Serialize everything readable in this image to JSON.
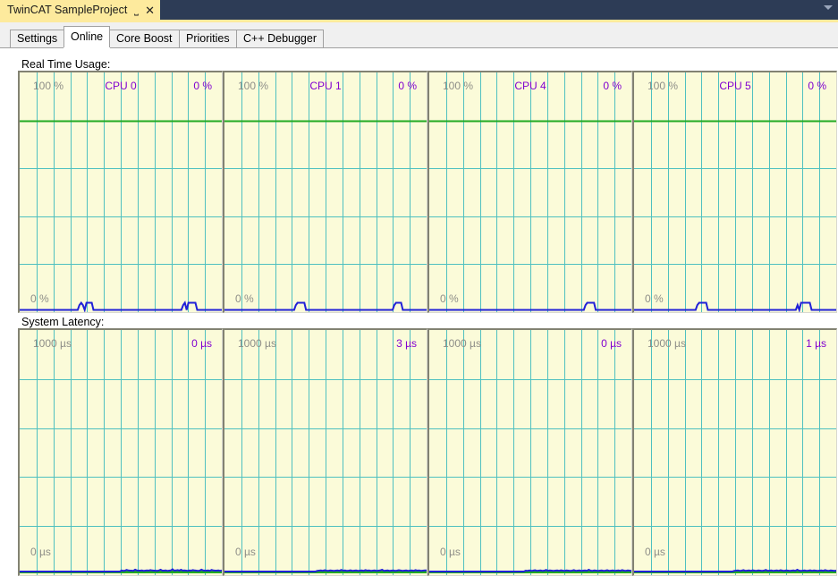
{
  "window": {
    "document_tab_title": "TwinCAT SampleProject",
    "pin_icon": "pin-icon",
    "close_icon": "close-icon",
    "menu_chevron_icon": "chevron-down-icon",
    "titlebar_color": "#2d3c56",
    "tab_color": "#fdea9d"
  },
  "tabs": [
    {
      "label": "Settings",
      "active": false
    },
    {
      "label": "Online",
      "active": true
    },
    {
      "label": "Core Boost",
      "active": false
    },
    {
      "label": "Priorities",
      "active": false
    },
    {
      "label": "C++ Debugger",
      "active": false
    }
  ],
  "sections": {
    "realtime_usage_label": "Real Time Usage:",
    "system_latency_label": "System Latency:"
  },
  "colors": {
    "chart_background": "#fbfbd9",
    "grid_line": "#4fc0c0",
    "trace_line": "#2020d8",
    "limit_line": "#22aa22",
    "axis_label": "#8e8e88",
    "value_label": "#8000d0",
    "frame_dark": "#828272"
  },
  "chart_data": [
    {
      "type": "line",
      "group": "Real Time Usage",
      "title": "CPU 0",
      "ylabel_max": "100 %",
      "ylabel_min": "0 %",
      "current_value": "0 %",
      "ylim": [
        0,
        100
      ],
      "limit_line_value": 80,
      "grid": {
        "vertical_lines": 11,
        "horizontal_lines": 4
      },
      "values": [
        0,
        0,
        0,
        0,
        0,
        0,
        0,
        0,
        0,
        0,
        0,
        0,
        0,
        0,
        0,
        0,
        0,
        0,
        0,
        0,
        0,
        0,
        0,
        0,
        0,
        0,
        0,
        0,
        0,
        0,
        0,
        0,
        0,
        0,
        2,
        3,
        2,
        0,
        3,
        3,
        3,
        3,
        0,
        0,
        0,
        0,
        0,
        0,
        0,
        0,
        0,
        0,
        0,
        0,
        0,
        0,
        0,
        0,
        0,
        0,
        0,
        0,
        0,
        0,
        0,
        0,
        0,
        0,
        0,
        0,
        0,
        0,
        0,
        0,
        0,
        0,
        0,
        0,
        0,
        0,
        0,
        0,
        0,
        0,
        0,
        0,
        0,
        0,
        0,
        0,
        0,
        0,
        0,
        2,
        3,
        0,
        3,
        3,
        3,
        3,
        3,
        0,
        0,
        0,
        0,
        0,
        0,
        0,
        0,
        0,
        0,
        0,
        0,
        0,
        0,
        0
      ]
    },
    {
      "type": "line",
      "group": "Real Time Usage",
      "title": "CPU 1",
      "ylabel_max": "100 %",
      "ylabel_min": "0 %",
      "current_value": "0 %",
      "ylim": [
        0,
        100
      ],
      "limit_line_value": 80,
      "grid": {
        "vertical_lines": 11,
        "horizontal_lines": 4
      },
      "values": [
        0,
        0,
        0,
        0,
        0,
        0,
        0,
        0,
        0,
        0,
        0,
        0,
        0,
        0,
        0,
        0,
        0,
        0,
        0,
        0,
        0,
        0,
        0,
        0,
        0,
        0,
        0,
        0,
        0,
        0,
        0,
        0,
        0,
        0,
        0,
        0,
        0,
        0,
        0,
        0,
        0,
        0,
        2,
        3,
        3,
        3,
        3,
        3,
        0,
        0,
        0,
        0,
        0,
        0,
        0,
        0,
        0,
        0,
        0,
        0,
        0,
        0,
        0,
        0,
        0,
        0,
        0,
        0,
        0,
        0,
        0,
        0,
        0,
        0,
        0,
        0,
        0,
        0,
        0,
        0,
        0,
        0,
        0,
        0,
        0,
        0,
        0,
        0,
        0,
        0,
        0,
        0,
        0,
        0,
        0,
        0,
        0,
        0,
        0,
        0,
        2,
        3,
        3,
        3,
        3,
        0,
        0,
        0,
        0,
        0,
        0,
        0,
        0,
        0,
        0,
        0,
        0,
        0,
        0,
        0
      ]
    },
    {
      "type": "line",
      "group": "Real Time Usage",
      "title": "CPU 4",
      "ylabel_max": "100 %",
      "ylabel_min": "0 %",
      "current_value": "0 %",
      "ylim": [
        0,
        100
      ],
      "limit_line_value": 80,
      "grid": {
        "vertical_lines": 11,
        "horizontal_lines": 4
      },
      "values": [
        0,
        0,
        0,
        0,
        0,
        0,
        0,
        0,
        0,
        0,
        0,
        0,
        0,
        0,
        0,
        0,
        0,
        0,
        0,
        0,
        0,
        0,
        0,
        0,
        0,
        0,
        0,
        0,
        0,
        0,
        0,
        0,
        0,
        0,
        0,
        0,
        0,
        0,
        0,
        0,
        0,
        0,
        0,
        0,
        0,
        0,
        0,
        0,
        0,
        0,
        0,
        0,
        0,
        0,
        0,
        0,
        0,
        0,
        0,
        0,
        0,
        0,
        0,
        0,
        0,
        0,
        0,
        0,
        0,
        0,
        0,
        0,
        0,
        0,
        0,
        0,
        0,
        0,
        0,
        0,
        0,
        0,
        0,
        0,
        0,
        0,
        0,
        0,
        0,
        0,
        0,
        0,
        2,
        3,
        3,
        3,
        3,
        3,
        0,
        0,
        0,
        0,
        0,
        0,
        0,
        0,
        0,
        0,
        0,
        0,
        0,
        0,
        0,
        0,
        0,
        0,
        0,
        0,
        0,
        0
      ]
    },
    {
      "type": "line",
      "group": "Real Time Usage",
      "title": "CPU 5",
      "ylabel_max": "100 %",
      "ylabel_min": "0 %",
      "current_value": "0 %",
      "ylim": [
        0,
        100
      ],
      "limit_line_value": 80,
      "grid": {
        "vertical_lines": 11,
        "horizontal_lines": 4
      },
      "values": [
        0,
        0,
        0,
        0,
        0,
        0,
        0,
        0,
        0,
        0,
        0,
        0,
        0,
        0,
        0,
        0,
        0,
        0,
        0,
        0,
        0,
        0,
        0,
        0,
        0,
        0,
        0,
        0,
        0,
        0,
        0,
        0,
        0,
        0,
        0,
        0,
        2,
        3,
        3,
        3,
        3,
        3,
        0,
        0,
        0,
        0,
        0,
        0,
        0,
        0,
        0,
        0,
        0,
        0,
        0,
        0,
        0,
        0,
        0,
        0,
        0,
        0,
        0,
        0,
        0,
        0,
        0,
        0,
        0,
        0,
        0,
        0,
        0,
        0,
        0,
        0,
        0,
        0,
        0,
        0,
        0,
        0,
        0,
        0,
        0,
        0,
        0,
        0,
        0,
        0,
        0,
        0,
        0,
        2,
        0,
        3,
        3,
        3,
        3,
        3,
        3,
        0,
        0,
        0,
        0,
        0,
        0,
        0,
        0,
        0,
        0,
        0,
        0,
        0,
        0,
        0
      ]
    },
    {
      "type": "line",
      "group": "System Latency",
      "title": "",
      "ylabel_max": "1000 µs",
      "ylabel_min": "0 µs",
      "current_value": "0 µs",
      "ylim": [
        0,
        1000
      ],
      "limit_line_value": 0,
      "grid": {
        "vertical_lines": 11,
        "horizontal_lines": 4
      },
      "values": [
        0,
        0,
        0,
        0,
        0,
        0,
        0,
        0,
        0,
        0,
        0,
        0,
        0,
        0,
        0,
        0,
        0,
        0,
        0,
        0,
        0,
        0,
        0,
        0,
        0,
        0,
        0,
        0,
        0,
        0,
        0,
        0,
        0,
        0,
        0,
        0,
        0,
        0,
        0,
        0,
        0,
        0,
        0,
        0,
        0,
        0,
        0,
        0,
        0,
        0,
        0,
        0,
        0,
        0,
        0,
        0,
        0,
        0,
        0,
        0,
        14,
        10,
        12,
        22,
        14,
        12,
        12,
        10,
        26,
        14,
        12,
        12,
        14,
        10,
        12,
        14,
        12,
        20,
        14,
        12,
        12,
        10,
        14,
        24,
        12,
        12,
        14,
        10,
        12,
        14,
        30,
        12,
        14,
        20,
        12,
        24,
        12,
        14,
        12,
        10,
        14,
        12,
        20,
        14,
        12,
        10,
        12,
        26,
        14,
        12,
        12,
        14,
        10,
        22,
        14,
        12,
        12,
        14,
        10,
        14
      ]
    },
    {
      "type": "line",
      "group": "System Latency",
      "title": "",
      "ylabel_max": "1000 µs",
      "ylabel_min": "0 µs",
      "current_value": "3 µs",
      "ylim": [
        0,
        1000
      ],
      "limit_line_value": 0,
      "grid": {
        "vertical_lines": 11,
        "horizontal_lines": 4
      },
      "values": [
        0,
        0,
        0,
        0,
        0,
        0,
        0,
        0,
        0,
        0,
        0,
        0,
        0,
        0,
        0,
        0,
        0,
        0,
        0,
        0,
        0,
        0,
        0,
        0,
        0,
        0,
        0,
        0,
        0,
        0,
        0,
        0,
        0,
        0,
        0,
        0,
        0,
        0,
        0,
        0,
        0,
        0,
        0,
        0,
        0,
        0,
        0,
        0,
        0,
        0,
        10,
        12,
        14,
        10,
        18,
        12,
        10,
        14,
        12,
        10,
        12,
        14,
        10,
        22,
        12,
        14,
        10,
        12,
        16,
        10,
        12,
        14,
        10,
        12,
        14,
        10,
        20,
        12,
        14,
        10,
        12,
        14,
        10,
        12,
        14,
        24,
        10,
        12,
        14,
        10,
        12,
        14,
        10,
        12,
        18,
        14,
        10,
        12,
        14,
        10,
        12,
        14,
        10,
        20,
        12,
        14,
        10,
        12,
        14,
        16
      ]
    },
    {
      "type": "line",
      "group": "System Latency",
      "title": "",
      "ylabel_max": "1000 µs",
      "ylabel_min": "0 µs",
      "current_value": "0 µs",
      "ylim": [
        0,
        1000
      ],
      "limit_line_value": 0,
      "grid": {
        "vertical_lines": 11,
        "horizontal_lines": 4
      },
      "values": [
        0,
        0,
        0,
        0,
        0,
        0,
        0,
        0,
        0,
        0,
        0,
        0,
        0,
        0,
        0,
        0,
        0,
        0,
        0,
        0,
        0,
        0,
        0,
        0,
        0,
        0,
        0,
        0,
        0,
        0,
        0,
        0,
        0,
        0,
        0,
        0,
        0,
        0,
        0,
        0,
        0,
        0,
        0,
        0,
        0,
        0,
        0,
        0,
        0,
        0,
        0,
        0,
        12,
        10,
        14,
        10,
        12,
        18,
        10,
        12,
        14,
        10,
        12,
        22,
        10,
        14,
        12,
        10,
        12,
        14,
        10,
        16,
        12,
        10,
        14,
        12,
        10,
        12,
        20,
        10,
        12,
        14,
        10,
        12,
        14,
        10,
        24,
        12,
        10,
        14,
        12,
        10,
        12,
        14,
        10,
        12,
        18,
        10,
        12,
        14,
        10,
        12,
        14,
        10,
        20,
        12,
        10,
        14,
        12,
        10
      ]
    },
    {
      "type": "line",
      "group": "System Latency",
      "title": "",
      "ylabel_max": "1000 µs",
      "ylabel_min": "0 µs",
      "current_value": "1 µs",
      "ylim": [
        0,
        1000
      ],
      "limit_line_value": 0,
      "grid": {
        "vertical_lines": 11,
        "horizontal_lines": 4
      },
      "values": [
        0,
        0,
        0,
        0,
        0,
        0,
        0,
        0,
        0,
        0,
        0,
        0,
        0,
        0,
        0,
        0,
        0,
        0,
        0,
        0,
        0,
        0,
        0,
        0,
        0,
        0,
        0,
        0,
        0,
        0,
        0,
        0,
        0,
        0,
        0,
        0,
        0,
        0,
        0,
        0,
        0,
        0,
        0,
        0,
        0,
        0,
        0,
        0,
        0,
        0,
        0,
        0,
        0,
        0,
        10,
        12,
        14,
        10,
        12,
        20,
        10,
        12,
        14,
        10,
        16,
        12,
        10,
        14,
        12,
        10,
        12,
        22,
        10,
        12,
        14,
        10,
        12,
        14,
        10,
        18,
        12,
        10,
        14,
        12,
        10,
        12,
        14,
        10,
        24,
        12,
        10,
        12,
        14,
        10,
        12,
        16,
        10,
        14,
        12,
        10,
        12,
        14,
        10,
        20,
        12,
        10,
        14,
        12,
        10,
        12
      ]
    }
  ]
}
